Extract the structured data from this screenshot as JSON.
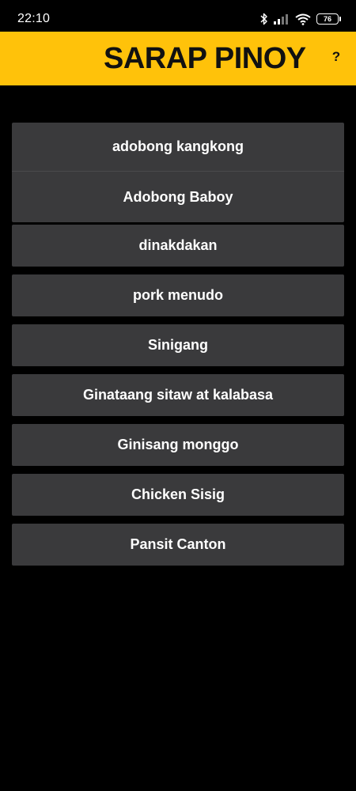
{
  "status_bar": {
    "time": "22:10",
    "battery_level": "76",
    "icons": [
      "bluetooth-icon",
      "signal-icon",
      "wifi-icon",
      "battery-icon"
    ]
  },
  "app_bar": {
    "title": "SARAP PINOY",
    "help_label": "?",
    "background_color": "#ffc20a"
  },
  "dishes": [
    {
      "label": "adobong kangkong"
    },
    {
      "label": "Adobong Baboy"
    },
    {
      "label": "dinakdakan"
    },
    {
      "label": "pork menudo"
    },
    {
      "label": "Sinigang"
    },
    {
      "label": "Ginataang sitaw at kalabasa"
    },
    {
      "label": "Ginisang monggo"
    },
    {
      "label": "Chicken Sisig"
    },
    {
      "label": "Pansit Canton"
    }
  ]
}
